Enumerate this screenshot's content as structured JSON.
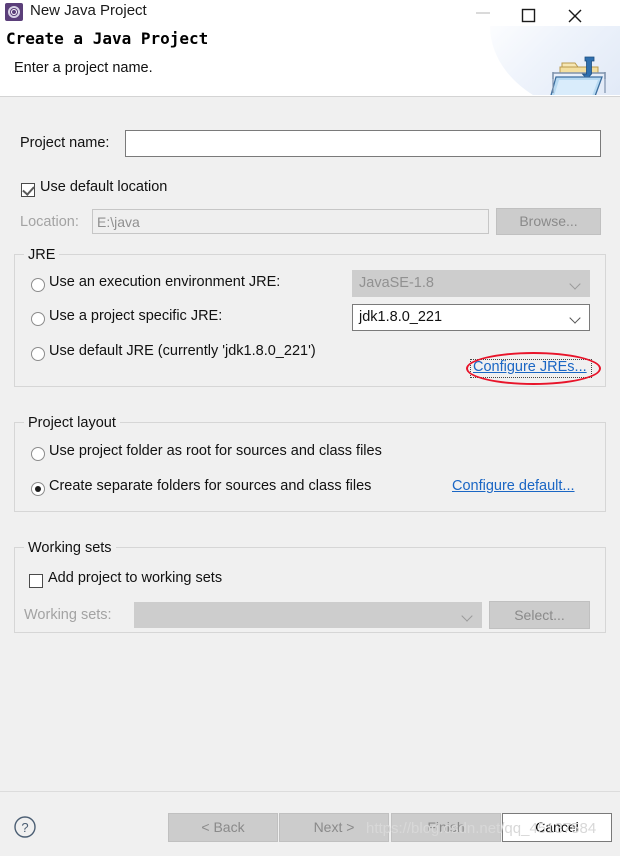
{
  "window": {
    "title": "New Java Project",
    "app_icon": "eclipse-icon",
    "controls": {
      "minimize": "minimize-icon",
      "maximize": "maximize-icon",
      "close": "close-icon"
    }
  },
  "banner": {
    "title": "Create a Java Project",
    "subtitle": "Enter a project name.",
    "icon": "java-project-folder-icon"
  },
  "form": {
    "project_name_label": "Project name:",
    "project_name_value": "",
    "use_default_location_label": "Use default location",
    "use_default_location_checked": true,
    "location_label": "Location:",
    "location_value": "E:\\java",
    "browse_label": "Browse..."
  },
  "jre": {
    "group_title": "JRE",
    "options": [
      {
        "label": "Use an execution environment JRE:",
        "selected": false,
        "combo_value": "JavaSE-1.8",
        "combo_enabled": false
      },
      {
        "label": "Use a project specific JRE:",
        "selected": true,
        "combo_value": "jdk1.8.0_221",
        "combo_enabled": true
      },
      {
        "label": "Use default JRE (currently 'jdk1.8.0_221')",
        "selected": false
      }
    ],
    "configure_link": "Configure JREs..."
  },
  "layout": {
    "group_title": "Project layout",
    "options": [
      {
        "label": "Use project folder as root for sources and class files",
        "selected": false
      },
      {
        "label": "Create separate folders for sources and class files",
        "selected": true
      }
    ],
    "configure_link": "Configure default..."
  },
  "working_sets": {
    "group_title": "Working sets",
    "add_label": "Add project to working sets",
    "add_checked": false,
    "sets_label": "Working sets:",
    "sets_value": "",
    "select_label": "Select..."
  },
  "footer": {
    "help_icon": "help-icon",
    "back_label": "< Back",
    "back_enabled": false,
    "next_label": "Next >",
    "next_enabled": false,
    "finish_label": "Finish",
    "finish_enabled": false,
    "cancel_label": "Cancel",
    "cancel_enabled": true
  },
  "watermark": "https://blog.csdn.net/qq_45137584",
  "colors": {
    "dialog_bg": "#f0f0f0",
    "link": "#1a66c4",
    "annotation_red": "#e8142a",
    "accent_icon": "#5b3f7a"
  }
}
